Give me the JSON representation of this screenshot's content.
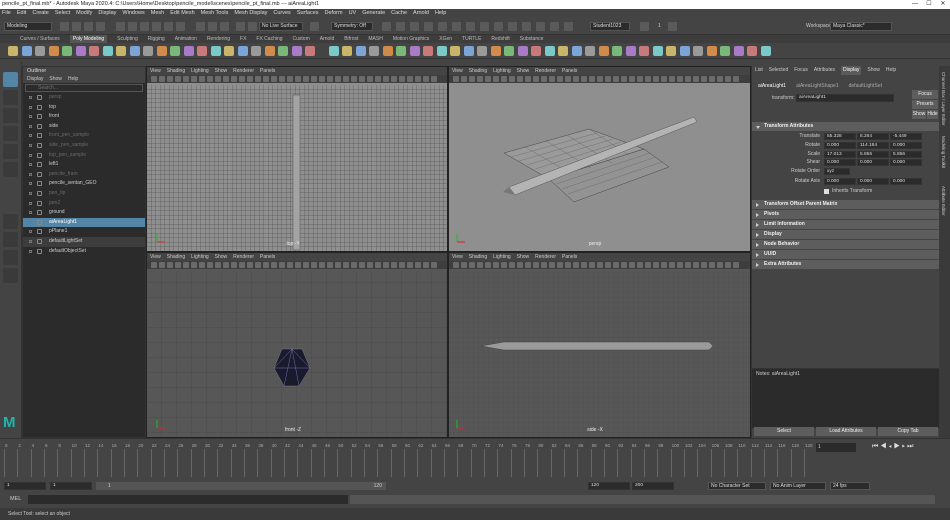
{
  "window": {
    "title": "pencile_pt_final.mb* - Autodesk Maya 2020.4: C:\\Users\\Home\\Desktop\\pencile_model\\scenes\\pencile_pt_final.mb  ---  aiAreaLight1",
    "min": "—",
    "max": "☐",
    "close": "✕"
  },
  "menubar": [
    "File",
    "Edit",
    "Create",
    "Select",
    "Modify",
    "Display",
    "Windows",
    "Mesh",
    "Edit Mesh",
    "Mesh Tools",
    "Mesh Display",
    "Curves",
    "Surfaces",
    "Deform",
    "UV",
    "Generate",
    "Cache",
    "Arnold",
    "Help"
  ],
  "status": {
    "mode": "Modeling",
    "live_surface": "No Live Surface",
    "symmetry": "Symmetry: Off",
    "workspace_label": "Workspace :",
    "workspace": "Maya Classic*",
    "user": "Student1023",
    "camera_value": "1"
  },
  "shelf_tabs": [
    "Curves / Surfaces",
    "Poly Modeling",
    "Sculpting",
    "Rigging",
    "Animation",
    "Rendering",
    "FX",
    "FX Caching",
    "Custom",
    "Arnold",
    "Bifrost",
    "MASH",
    "Motion Graphics",
    "XGen",
    "TURTLE",
    "Redshift",
    "Substance"
  ],
  "shelf_active": "Poly Modeling",
  "outliner": {
    "title": "Outliner",
    "menu": [
      "Display",
      "Show",
      "Help"
    ],
    "search_placeholder": "Search...",
    "items": [
      {
        "label": "persp",
        "style": "dim"
      },
      {
        "label": "top",
        "style": "normal"
      },
      {
        "label": "front",
        "style": "normal"
      },
      {
        "label": "side",
        "style": "normal"
      },
      {
        "label": "front_pen_sample",
        "style": "dim"
      },
      {
        "label": "side_pen_sample",
        "style": "dim"
      },
      {
        "label": "top_pen_sample",
        "style": "dim"
      },
      {
        "label": "left1",
        "style": "normal"
      },
      {
        "label": "pencile_fram",
        "style": "dim"
      },
      {
        "label": "pencile_sentan_GEO",
        "style": "normal"
      },
      {
        "label": "pen_tip",
        "style": "dim"
      },
      {
        "label": "pen2",
        "style": "dim"
      },
      {
        "label": "ground",
        "style": "normal"
      },
      {
        "label": "aiAreaLight1",
        "style": "sel"
      },
      {
        "label": "pPlane1",
        "style": "normal"
      },
      {
        "label": "defaultLightSet",
        "style": "hl"
      },
      {
        "label": "defaultObjectSet",
        "style": "normal"
      }
    ]
  },
  "viewport_menu": [
    "View",
    "Shading",
    "Lighting",
    "Show",
    "Renderer",
    "Panels"
  ],
  "viewports": [
    {
      "label": "top -Y"
    },
    {
      "label": "persp"
    },
    {
      "label": "front -Z"
    },
    {
      "label": "side -X"
    }
  ],
  "attribute_editor": {
    "menu": [
      "List",
      "Selected",
      "Focus",
      "Attributes",
      "Display",
      "Show",
      "Help"
    ],
    "menu_active": "Display",
    "tabs": [
      "aiAreaLight1",
      "aiAreaLightShape1",
      "defaultLightSet"
    ],
    "transform_label": "transform:",
    "transform_value": "aiAreaLight1",
    "focus": "Focus",
    "presets": "Presets",
    "show": "Show",
    "hide": "Hide",
    "transform_section": "Transform Attributes",
    "rows": [
      {
        "label": "Translate",
        "values": [
          "55.328",
          "8.264",
          "-5.449"
        ]
      },
      {
        "label": "Rotate",
        "values": [
          "0.000",
          "114.184",
          "0.000"
        ]
      },
      {
        "label": "Scale",
        "values": [
          "17.013",
          "5.856",
          "5.856"
        ]
      },
      {
        "label": "Shear",
        "values": [
          "0.000",
          "0.000",
          "0.000"
        ]
      }
    ],
    "rotate_order_label": "Rotate Order",
    "rotate_order": "xyz",
    "rotate_axis_label": "Rotate Axis",
    "rotate_axis": [
      "0.000",
      "0.000",
      "0.000"
    ],
    "inherits": "Inherits Transform",
    "sections": [
      "Transform Offset Parent Matrix",
      "Pivots",
      "Limit Information",
      "Display",
      "Node Behavior",
      "UUID",
      "Extra Attributes"
    ],
    "notes": "Notes:  aiAreaLight1",
    "buttons": [
      "Select",
      "Load Attributes",
      "Copy Tab"
    ]
  },
  "sidetabs": [
    "Channel Box / Layer Editor",
    "Modeling Toolkit",
    "Attribute Editor"
  ],
  "timeline": {
    "ticks": [
      0,
      2,
      4,
      6,
      8,
      10,
      12,
      14,
      16,
      18,
      20,
      22,
      24,
      26,
      28,
      30,
      32,
      34,
      36,
      38,
      40,
      42,
      44,
      46,
      48,
      50,
      52,
      54,
      56,
      58,
      60,
      62,
      64,
      66,
      68,
      70,
      72,
      74,
      76,
      78,
      80,
      82,
      84,
      86,
      88,
      90,
      92,
      94,
      96,
      98,
      100,
      102,
      104,
      106,
      108,
      110,
      112,
      114,
      116,
      118,
      120
    ],
    "current": "1"
  },
  "range": {
    "start": "1",
    "start2": "1",
    "slider_start": "1",
    "slider_end": "120",
    "end": "120",
    "end2": "200",
    "character_set": "No Character Set",
    "anim_layer": "No Anim Layer",
    "fps": "24 fps"
  },
  "cmd": {
    "label": "MEL"
  },
  "help": "Select Tool: select an object",
  "colors": {
    "accent": "#5285a6",
    "bg": "#444444",
    "panel": "#2b2b2b"
  }
}
